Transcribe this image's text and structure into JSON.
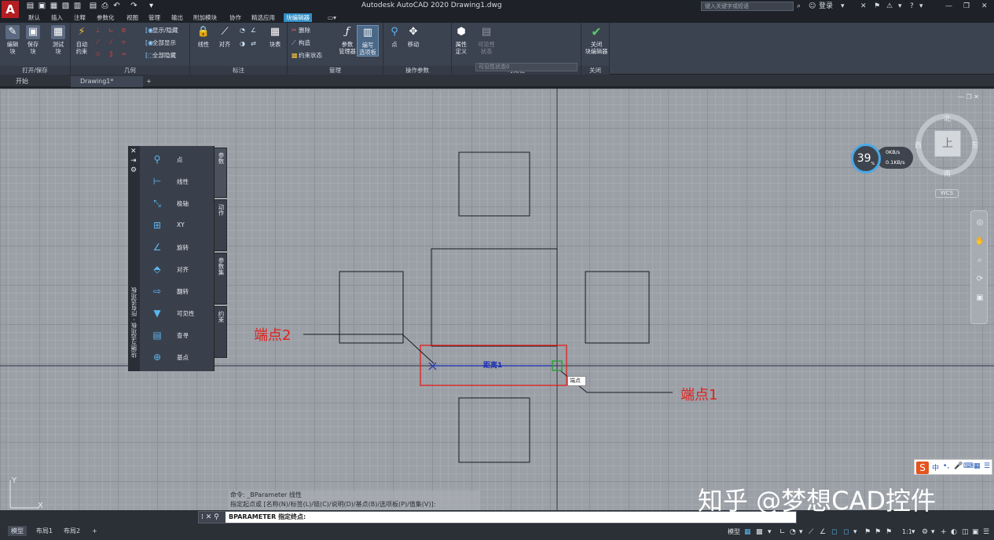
{
  "app": {
    "logo_letter": "A",
    "title": "Autodesk AutoCAD 2020    Drawing1.dwg",
    "search_placeholder": "键入关键字或短语",
    "login": "登录"
  },
  "menu_tabs": [
    "默认",
    "插入",
    "注释",
    "参数化",
    "视图",
    "管理",
    "输出",
    "附加模块",
    "协作",
    "精选应用",
    "块编辑器",
    "▭▾"
  ],
  "ribbon": {
    "panels": {
      "open_save": "打开/保存",
      "geometry": "几何",
      "dimension": "标注",
      "manage": "管理",
      "action_params": "操作参数",
      "visibility": "可见性",
      "close": "关闭"
    },
    "buttons": {
      "edit_block": "编辑\n块",
      "save_block": "保存\n块",
      "test_block": "测试\n块",
      "auto_constrain": "自动\n约束",
      "show_hide": "显示/隐藏",
      "show_all": "全部显示",
      "hide_all": "全部隐藏",
      "linear": "线性",
      "aligned": "对齐",
      "block_table": "块表",
      "delete": "删除",
      "construction": "构造",
      "constraint_status": "约束状态",
      "param_manager": "参数\n管理器",
      "authoring_palettes": "编写\n选项板",
      "point": "点",
      "move": "移动",
      "attribute_def": "属性\n定义",
      "visibility_states": "可见性\n状态",
      "close_editor": "关闭\n块编辑器"
    },
    "visibility_dropdown": "可见性状态0"
  },
  "doc_tabs": [
    "开始",
    "Drawing1*",
    "+"
  ],
  "palette": {
    "title": "块编写选项板 - 所有选项板",
    "items": [
      "点",
      "线性",
      "极轴",
      "XY",
      "旋转",
      "对齐",
      "翻转",
      "可见性",
      "查寻",
      "基点"
    ],
    "tabs": [
      "参数",
      "动作",
      "参数集",
      "约束"
    ]
  },
  "canvas": {
    "annotation_endpoint2": "端点2",
    "annotation_endpoint1": "端点1",
    "distance_label": "距离1",
    "grip_tooltip": "端点"
  },
  "navigation": {
    "viewcube_north": "北",
    "viewcube_south": "南",
    "viewcube_east": "东",
    "viewcube_west": "西",
    "viewcube_top": "上",
    "wcs": "WCS",
    "performance_value": "39",
    "performance_unit": "%",
    "perf_up": "0KB/s",
    "perf_down": "0.1KB/s"
  },
  "command": {
    "history_line1": "命令:  _BParameter 线性",
    "history_line2": "指定起点或 [名称(N)/标签(L)/链(C)/说明(D)/基点(B)/选项板(P)/值集(V)]:",
    "prompt": "BPARAMETER 指定终点:"
  },
  "ime": {
    "chinese": "中",
    "punct": "•,"
  },
  "watermark": "知乎 @梦想CAD控件",
  "status": {
    "layout_tabs": [
      "模型",
      "布局1",
      "布局2",
      "+"
    ],
    "model_label": "模型",
    "scale": "1:1"
  },
  "colors": {
    "accent": "#2f8ec5",
    "annotation_red": "#e0211b",
    "param_blue": "#1b2fb5",
    "logo_red": "#b51d22"
  }
}
